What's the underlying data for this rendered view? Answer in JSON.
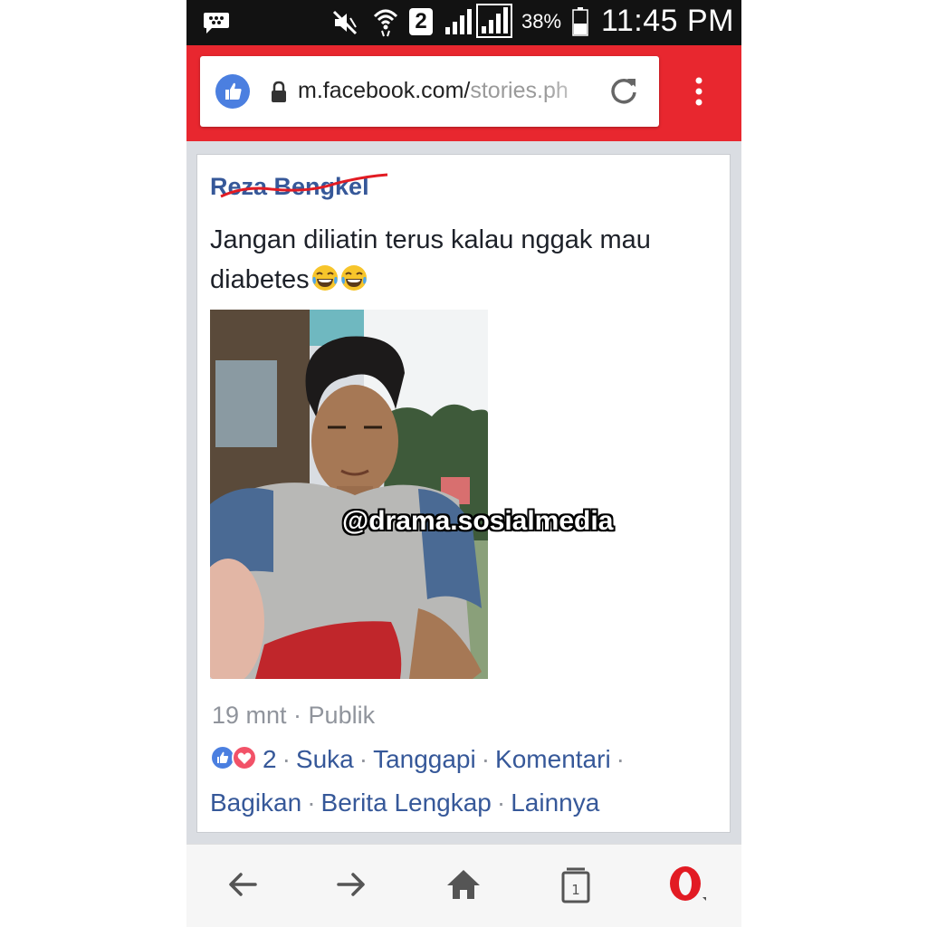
{
  "status_bar": {
    "sim_slot": "2",
    "battery": "38%",
    "time": "11:45 PM"
  },
  "browser": {
    "url_main": "m.facebook.com/",
    "url_path": "stories.ph"
  },
  "post": {
    "author": "Reza Bengkel",
    "text": "Jangan diliatin terus kalau nggak mau diabetes",
    "emoji": [
      "face-with-tears-of-joy",
      "face-with-tears-of-joy"
    ],
    "watermark": "@drama.sosialmedia",
    "time": "19 mnt",
    "visibility": "Publik",
    "reaction_count": "2",
    "actions": {
      "like": "Suka",
      "react": "Tanggapi",
      "comment": "Komentari",
      "share": "Bagikan",
      "full_story": "Berita Lengkap",
      "more": "Lainnya"
    }
  },
  "navbar": {
    "tab_count": "1"
  },
  "colors": {
    "browser_red": "#e8272f",
    "facebook_blue": "#365899",
    "muted_gray": "#90949c"
  }
}
